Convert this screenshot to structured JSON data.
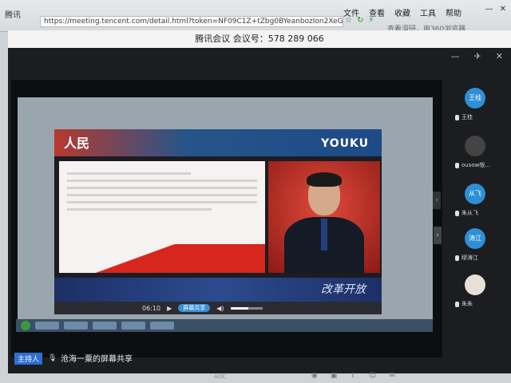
{
  "browser": {
    "tab_label": "腾讯",
    "url": "https://meeting.tencent.com/detail.html?token=NF09C1Z+tZbg0BYeanbozIon2XeGnZIbQG",
    "menu": [
      "文件",
      "查看",
      "收藏",
      "工具",
      "帮助"
    ],
    "search_hint": "查看溜研，用360浏览器"
  },
  "meeting": {
    "title": "腾讯会议 会议号：578 289 066",
    "share_label": "沧海一粟的屏幕共享",
    "host_tag": "主持人"
  },
  "shared_screen": {
    "player_brand": "YOUKU",
    "logo_text": "人民",
    "slogan": "改革开放",
    "share_pill": "屏幕共享",
    "time": "06:10",
    "progress": 0.55
  },
  "participants": [
    {
      "name": "王桂",
      "avatar_text": "王桂",
      "color": "#2e8fd6"
    },
    {
      "name": "ousow恨...",
      "avatar_text": "",
      "color": "#444"
    },
    {
      "name": "朱从飞",
      "avatar_text": "从飞",
      "color": "#2e8fd6"
    },
    {
      "name": "缪涛江",
      "avatar_text": "涛江",
      "color": "#2e8fd6"
    },
    {
      "name": "朱朱",
      "avatar_text": "",
      "color": "#e8e0d8"
    }
  ],
  "monitor": {
    "brand": "AOC"
  }
}
